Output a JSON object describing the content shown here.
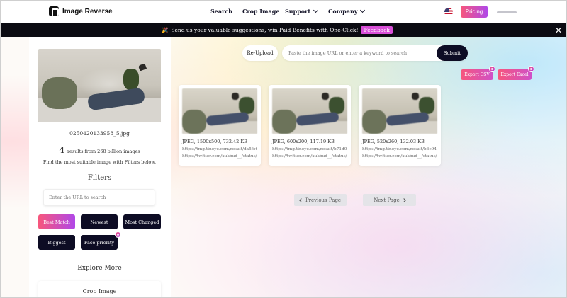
{
  "header": {
    "brand": "Image Reverse",
    "nav": [
      {
        "label": "Search"
      },
      {
        "label": "Crop Image"
      },
      {
        "label": "Support"
      },
      {
        "label": "Company"
      }
    ],
    "pricing_label": "Pricing"
  },
  "banner": {
    "emoji": "🎉",
    "text": "Send us your valuable suggestions, win Paid Benefits with One-Click!",
    "feedback_label": "Feedback",
    "close_glyph": "✕"
  },
  "sidebar": {
    "filename": "0250420133958_5.jpg",
    "result_count": "4",
    "result_text": "results from 268 billion images",
    "hint": "Find the most suitable image with Filters below.",
    "filters_title": "Filters",
    "url_placeholder": "Enter the URL to search",
    "filter_buttons": [
      {
        "label": "Best Match"
      },
      {
        "label": "Newest"
      },
      {
        "label": "Most Changed"
      },
      {
        "label": "Biggest"
      },
      {
        "label": "Face priority"
      }
    ],
    "explore_title": "Explore More",
    "explore_items": [
      {
        "label": "Crop Image"
      }
    ]
  },
  "search": {
    "reupload_label": "Re-Upload",
    "placeholder": "Paste the image URL or enter a keyword to search",
    "submit_label": "Submit"
  },
  "exports": {
    "csv_label": "Export CSV",
    "excel_label": "Export Excel"
  },
  "results": [
    {
      "meta": "JPEG, 1500x500, 732.42 KB",
      "link1": "https://img.tineye.com/result/da5fe6b0b...",
      "link2": "https://twitter.com/xukbud__/status/133..."
    },
    {
      "meta": "JPEG, 600x200, 117.19 KB",
      "link1": "https://img.tineye.com/result/b71d0c85...",
      "link2": "https://twitter.com/xukbud__/status/133..."
    },
    {
      "meta": "JPEG, 520x260, 132.03 KB",
      "link1": "https://img.tineye.com/result/b6c94a6ed...",
      "link2": "https://twitter.com/xukbud__/status/133..."
    }
  ],
  "pagination": {
    "prev_label": "Previous Page",
    "next_label": "Next Page"
  },
  "colors": {
    "accent_gradient_start": "#f7567c",
    "accent_gradient_end": "#b048e8",
    "dark_button": "#0d0c24",
    "banner_bg": "#0b0b12"
  }
}
